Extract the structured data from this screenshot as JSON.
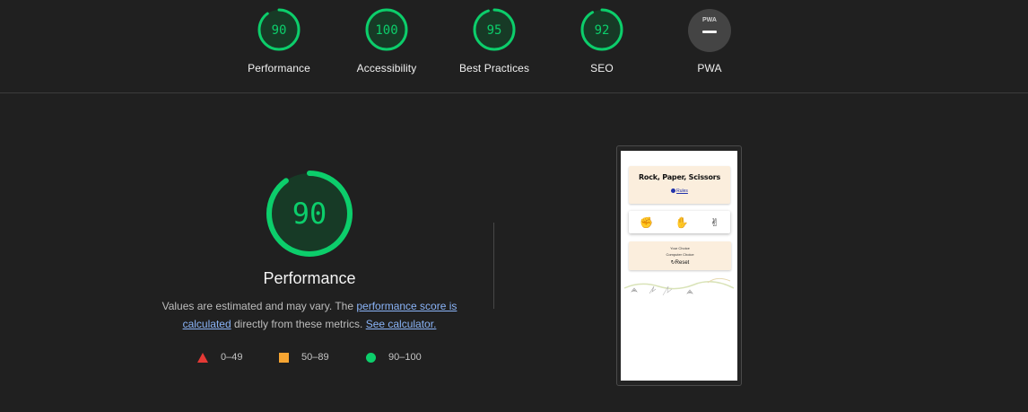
{
  "categories": [
    {
      "id": "performance",
      "label": "Performance",
      "score": "90"
    },
    {
      "id": "accessibility",
      "label": "Accessibility",
      "score": "100"
    },
    {
      "id": "best-practices",
      "label": "Best Practices",
      "score": "95"
    },
    {
      "id": "seo",
      "label": "SEO",
      "score": "92"
    },
    {
      "id": "pwa",
      "label": "PWA",
      "badge": "PWA"
    }
  ],
  "main": {
    "score": "90",
    "title": "Performance",
    "desc_prefix": "Values are estimated and may vary. The ",
    "desc_link": "performance score is calculated",
    "desc_mid": " directly from these metrics. ",
    "calc_link": "See calculator."
  },
  "legend": [
    {
      "shape": "triangle",
      "range": "0–49",
      "color": "#e53935"
    },
    {
      "shape": "square",
      "range": "50–89",
      "color": "#f6a532"
    },
    {
      "shape": "circle",
      "range": "90–100",
      "color": "#0cce6b"
    }
  ],
  "screenshot": {
    "title": "Rock, Paper, Scissors",
    "rules": "Rules",
    "your_choice": "Your Choice",
    "computer_choice": "Computer Choice",
    "reset": "Reset"
  },
  "colors": {
    "pass": "#0cce6b",
    "pass_bg": "#173a26",
    "background": "#202020"
  }
}
